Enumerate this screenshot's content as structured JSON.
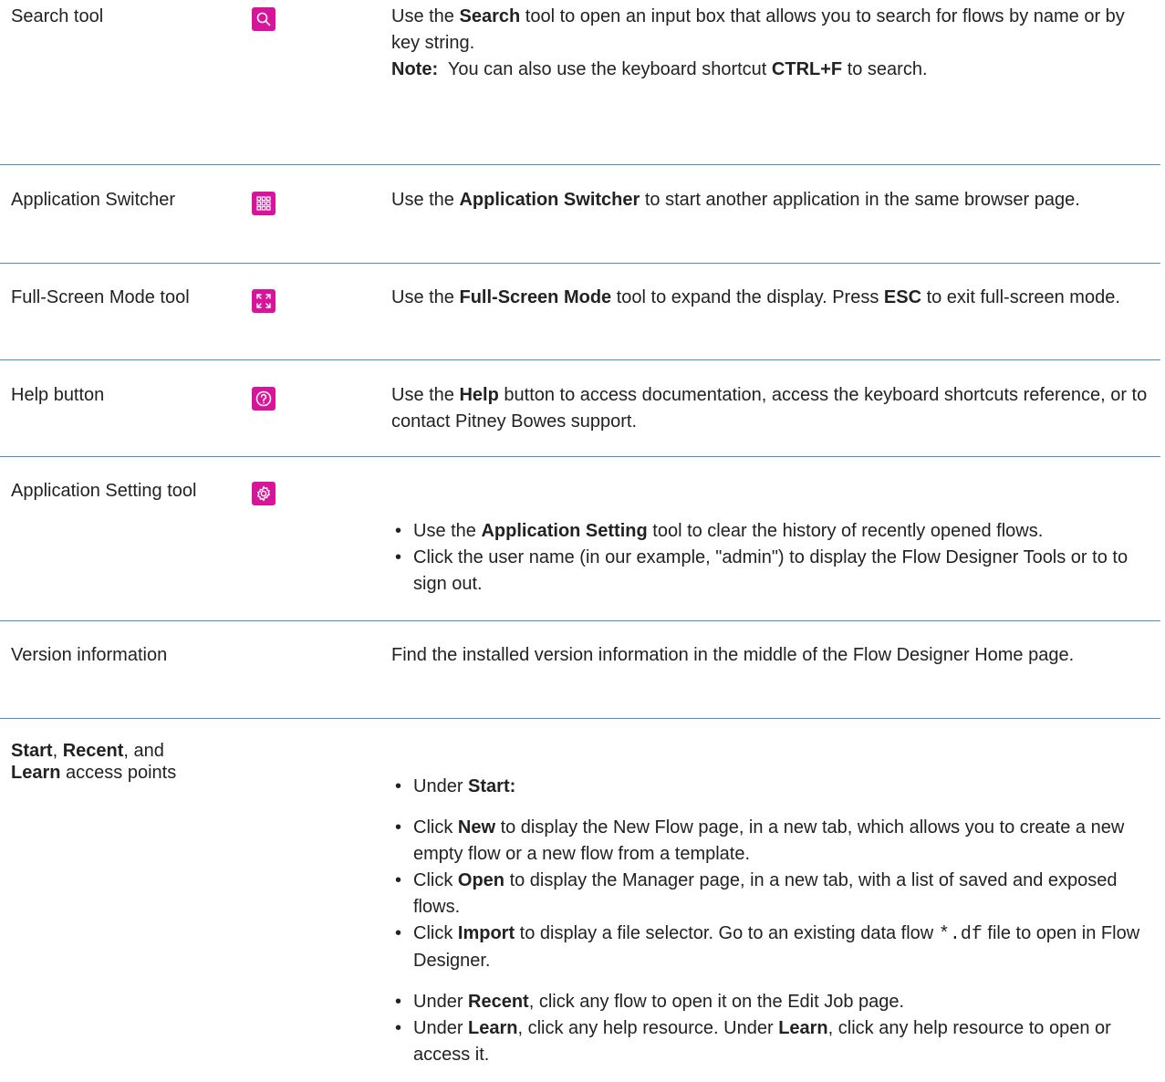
{
  "colors": {
    "accent": "#d6159b",
    "divider": "#4a90c8"
  },
  "rows": [
    {
      "label": "Search tool",
      "icon": "search-icon",
      "desc": {
        "pre": "Use the ",
        "bold": "Search",
        "post": " tool to open an input box that allows you to search for flows by name or by key string.",
        "note_label": "Note:",
        "note_pre": "  You can also use the keyboard shortcut ",
        "note_bold": "CTRL+F",
        "note_post": " to search."
      }
    },
    {
      "label": "Application Switcher",
      "icon": "grid-icon",
      "desc": {
        "pre": "Use the ",
        "bold": "Application Switcher",
        "post": " to start another application in the same browser page."
      }
    },
    {
      "label": "Full-Screen Mode tool",
      "icon": "fullscreen-icon",
      "desc": {
        "pre": "Use the ",
        "bold": "Full-Screen Mode",
        "mid": " tool to expand the display. Press ",
        "bold2": "ESC",
        "post": " to exit full-screen mode."
      }
    },
    {
      "label": "Help button",
      "icon": "help-icon",
      "desc": {
        "pre": "Use the ",
        "bold": "Help",
        "post": " button to access documentation, access the keyboard shortcuts reference, or to contact Pitney Bowes support."
      }
    },
    {
      "label": "Application Setting tool",
      "icon": "gear-icon",
      "bullets": [
        {
          "pre": "Use the ",
          "bold": "Application Setting",
          "post": " tool to clear the history of recently opened flows."
        },
        {
          "pre": "Click the user name (in our example, \"admin\") to display the Flow Designer Tools or to to sign out."
        }
      ]
    },
    {
      "label": "Version information",
      "desc": {
        "pre": "Find the installed version information in the middle of the Flow Designer Home page."
      }
    },
    {
      "label": {
        "b1": "Start",
        "t1": ", ",
        "b2": "Recent",
        "t2": ", and",
        "b3": "Learn",
        "t3": " access points"
      },
      "bullets": [
        {
          "pre": "Under ",
          "bold": "Start:"
        },
        {
          "pre": "Under ",
          "bold": "Recent",
          "post": ", click any flow to open it on the Edit Job page."
        },
        {
          "pre": "Under ",
          "bold": "Learn",
          "mid": ", click any help resource. Under ",
          "bold2": "Learn",
          "post": ", click any help resource to open or access it."
        }
      ],
      "sub_bullets": [
        {
          "pre": "Click ",
          "bold": "New",
          "post": " to display the New Flow page, in a new tab, which allows you to create a new empty flow or a new flow from a template."
        },
        {
          "pre": "Click ",
          "bold": "Open",
          "post": " to display the Manager page, in a new tab, with a list of saved and exposed flows."
        },
        {
          "pre": "Click ",
          "bold": "Import",
          "mid": " to display a file selector. Go to an existing data flow ",
          "code": "*.df",
          "post": " file to open in Flow Designer."
        }
      ]
    }
  ]
}
